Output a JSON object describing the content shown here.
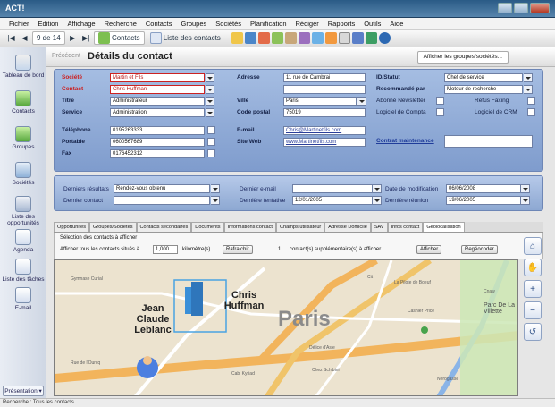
{
  "window": {
    "title": "ACT!"
  },
  "menu": [
    "Fichier",
    "Edition",
    "Affichage",
    "Recherche",
    "Contacts",
    "Groupes",
    "Sociétés",
    "Planification",
    "Rédiger",
    "Rapports",
    "Outils",
    "Aide"
  ],
  "toolbar": {
    "record": "9 de 14",
    "contacts": "Contacts",
    "contact_list": "Liste des contacts"
  },
  "header": {
    "previous": "Précédent",
    "title": "Détails du contact",
    "groups_button": "Afficher les groupes/sociétés..."
  },
  "nav": [
    "Tableau de bord",
    "Contacts",
    "Groupes",
    "Sociétés",
    "Liste des opportunités",
    "Agenda",
    "Liste des tâches",
    "E-mail",
    "Présentation"
  ],
  "form": {
    "societe": {
      "label": "Société",
      "value": "Martin et Fils"
    },
    "contact": {
      "label": "Contact",
      "value": "Chris Huffman"
    },
    "titre": {
      "label": "Titre",
      "value": "Administrateur"
    },
    "service": {
      "label": "Service",
      "value": "Administration"
    },
    "telephone": {
      "label": "Téléphone",
      "value": "0195263333"
    },
    "portable": {
      "label": "Portable",
      "value": "0600567689"
    },
    "fax": {
      "label": "Fax",
      "value": "0176452312"
    },
    "adresse": {
      "label": "Adresse",
      "value": "11 rue de Cambrai"
    },
    "ville": {
      "label": "Ville",
      "value": "Paris"
    },
    "code_postal": {
      "label": "Code postal",
      "value": "75019"
    },
    "email": {
      "label": "E-mail",
      "value": "Chris@Martinetfils.com"
    },
    "site_web": {
      "label": "Site Web",
      "value": "www.Martinetfils.com"
    },
    "statut": {
      "label": "ID/Statut",
      "value": "Chef de service"
    },
    "recommande": {
      "label": "Recommandé par",
      "value": "Moteur de recherche"
    },
    "newsletter": {
      "label": "Abonné Newsletter"
    },
    "faxing": {
      "label": "Refus Faxing"
    },
    "compta": {
      "label": "Logiciel de Compta"
    },
    "crm": {
      "label": "Logiciel de CRM"
    },
    "contrat": {
      "label": "Contrat maintenance"
    }
  },
  "actions": {
    "resultats": {
      "label": "Derniers résultats",
      "value": "Rendez-vous obtenu"
    },
    "contact": {
      "label": "Dernier contact"
    },
    "email": {
      "label": "Dernier e-mail"
    },
    "tentative": {
      "label": "Dernière tentative",
      "value": "12/01/2005"
    },
    "modif": {
      "label": "Date de modification",
      "value": "06/06/2008"
    },
    "reunion": {
      "label": "Dernière réunion",
      "value": "19/06/2005"
    }
  },
  "tabs": [
    "Opportunités",
    "Groupes/Sociétés",
    "Contacts secondaires",
    "Documents",
    "Informations contact",
    "Champs utilisateur",
    "Adresse Domicile",
    "SAV",
    "Infos contact",
    "Géolocalisation"
  ],
  "geo": {
    "title": "Sélection des contacts à afficher",
    "line": "Afficher tous les contacts situés à",
    "distance": "1,000",
    "unit": "kilomètre(s).",
    "refresh": "Rafraichir",
    "count": "1",
    "count_text": "contact(s) supplémentaire(s) à afficher.",
    "show": "Afficher",
    "regeocode": "Regéocoder"
  },
  "map": {
    "names": {
      "jean": "Jean Claude Leblanc",
      "chris": "Chris Huffman",
      "paris": "Paris"
    },
    "labels": [
      "Gymnase Curial",
      "Rue de l'Ourcq",
      "Cit",
      "La Pilote de Boeuf",
      "Cashier Price",
      "Délice d'Asie",
      "Chez Schibini",
      "Cabi Kyriad",
      "Nerogasse",
      "Cnaw",
      "Parc De La Villette"
    ],
    "extra": [
      "Coccinquant",
      "Metro Corentin Cariou",
      "Rue Riquet",
      "Rue de Tanger",
      "Rue de l'Oise",
      "Crimée",
      "Flandre",
      "Supermarché Franprix",
      "Pizzeria"
    ]
  },
  "status": "Recherche : Tous les contacts"
}
